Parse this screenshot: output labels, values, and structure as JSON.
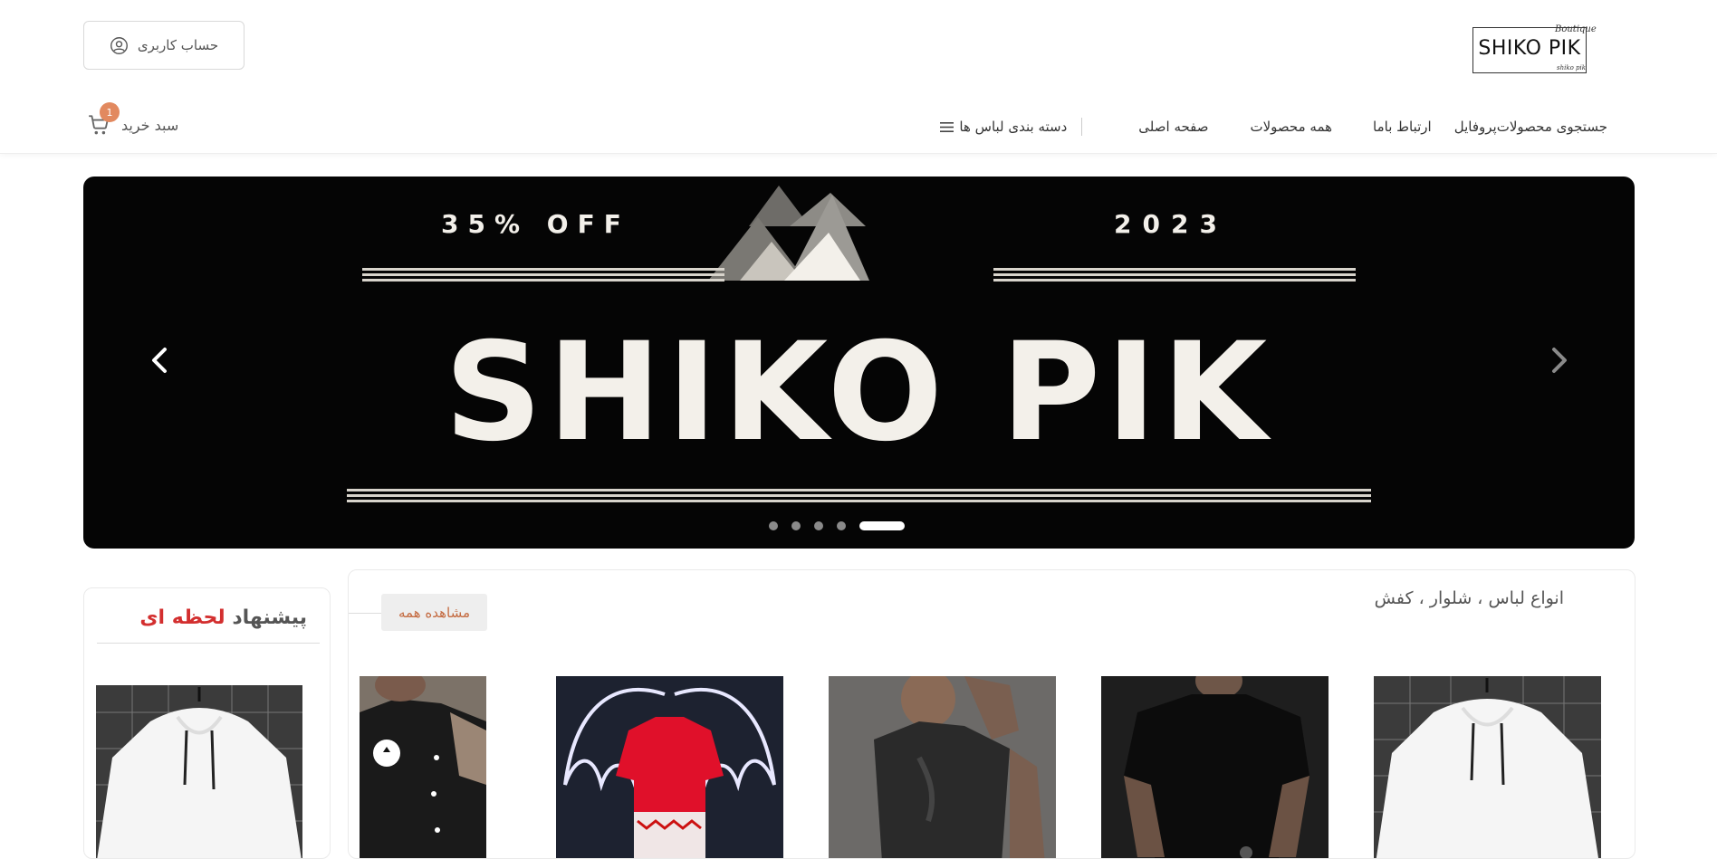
{
  "header": {
    "logo": {
      "text": "SHIKO PIK",
      "script_top": "Boutique",
      "script_bottom": "shiko pik"
    },
    "account_label": "حساب کاربری",
    "cart": {
      "label": "سبد خرید",
      "count": "1"
    },
    "nav": {
      "categories_label": "دسته بندی لباس ها",
      "items": [
        "صفحه اصلی",
        "همه محصولات",
        "ارتباط باما",
        "پروفایل",
        "جستجوی محصولات"
      ]
    }
  },
  "slider": {
    "banner_top_left": "35% OFF",
    "banner_top_right": "2023",
    "banner_title": "SHIKO PIK",
    "slide_count": 5,
    "active_index": 4
  },
  "offer": {
    "title_part1": "پیشنهاد",
    "title_part2": "لحظه ای"
  },
  "products_section": {
    "title": "انواع لباس ، شلوار ، کفش",
    "see_all": "مشاهده همه"
  },
  "colors": {
    "accent": "#e2895f",
    "offer_red": "#d32f2f",
    "see_all_text": "#c46a40",
    "banner_bg": "#050505"
  }
}
